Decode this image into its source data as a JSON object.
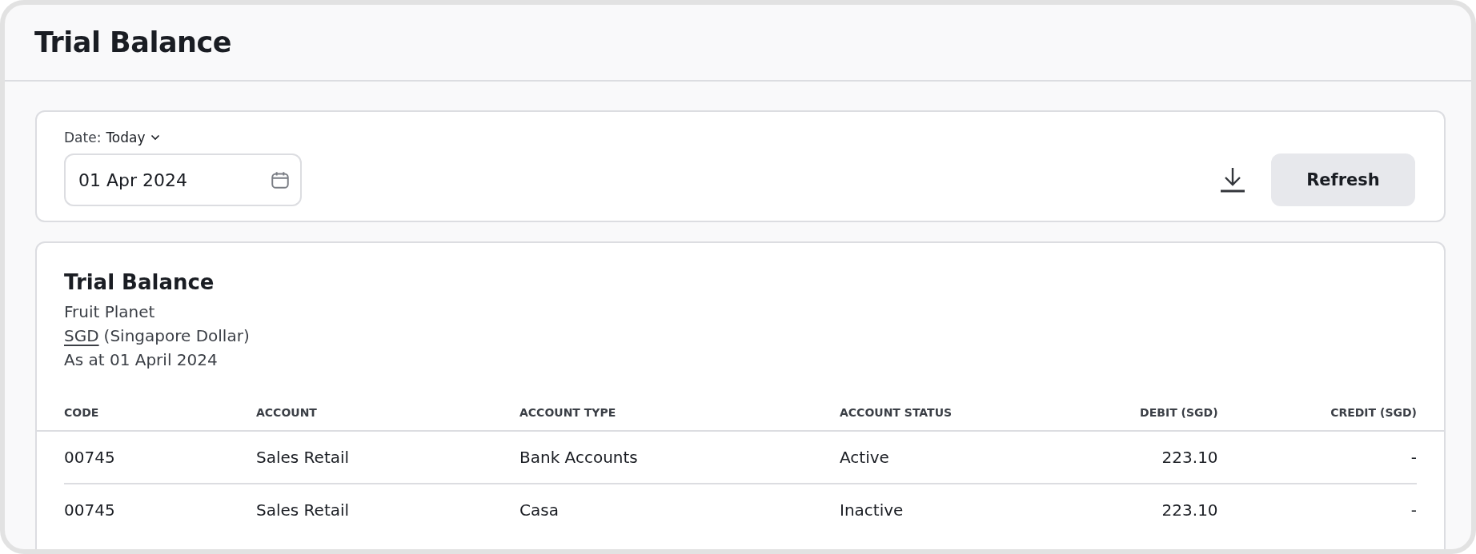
{
  "page": {
    "title": "Trial Balance"
  },
  "filters": {
    "date_label": "Date:",
    "date_range": "Today",
    "date_value": "01 Apr 2024",
    "refresh_button": "Refresh"
  },
  "report": {
    "title": "Trial Balance",
    "organisation": "Fruit Planet",
    "currency_code": "SGD",
    "currency_name": "(Singapore Dollar)",
    "as_at": "As at 01 April 2024",
    "table": {
      "columns": [
        {
          "label": "CODE",
          "kind": "text"
        },
        {
          "label": "ACCOUNT",
          "kind": "text"
        },
        {
          "label": "ACCOUNT TYPE",
          "kind": "text"
        },
        {
          "label": "ACCOUNT STATUS",
          "kind": "text"
        },
        {
          "label": "DEBIT (SGD)",
          "kind": "amount"
        },
        {
          "label": "CREDIT (SGD)",
          "kind": "amount"
        }
      ],
      "rows": [
        [
          "00745",
          "Sales Retail",
          "Bank Accounts",
          "Active",
          "223.10",
          "-"
        ],
        [
          "00745",
          "Sales Retail",
          "Casa",
          "Inactive",
          "223.10",
          "-"
        ]
      ]
    }
  }
}
